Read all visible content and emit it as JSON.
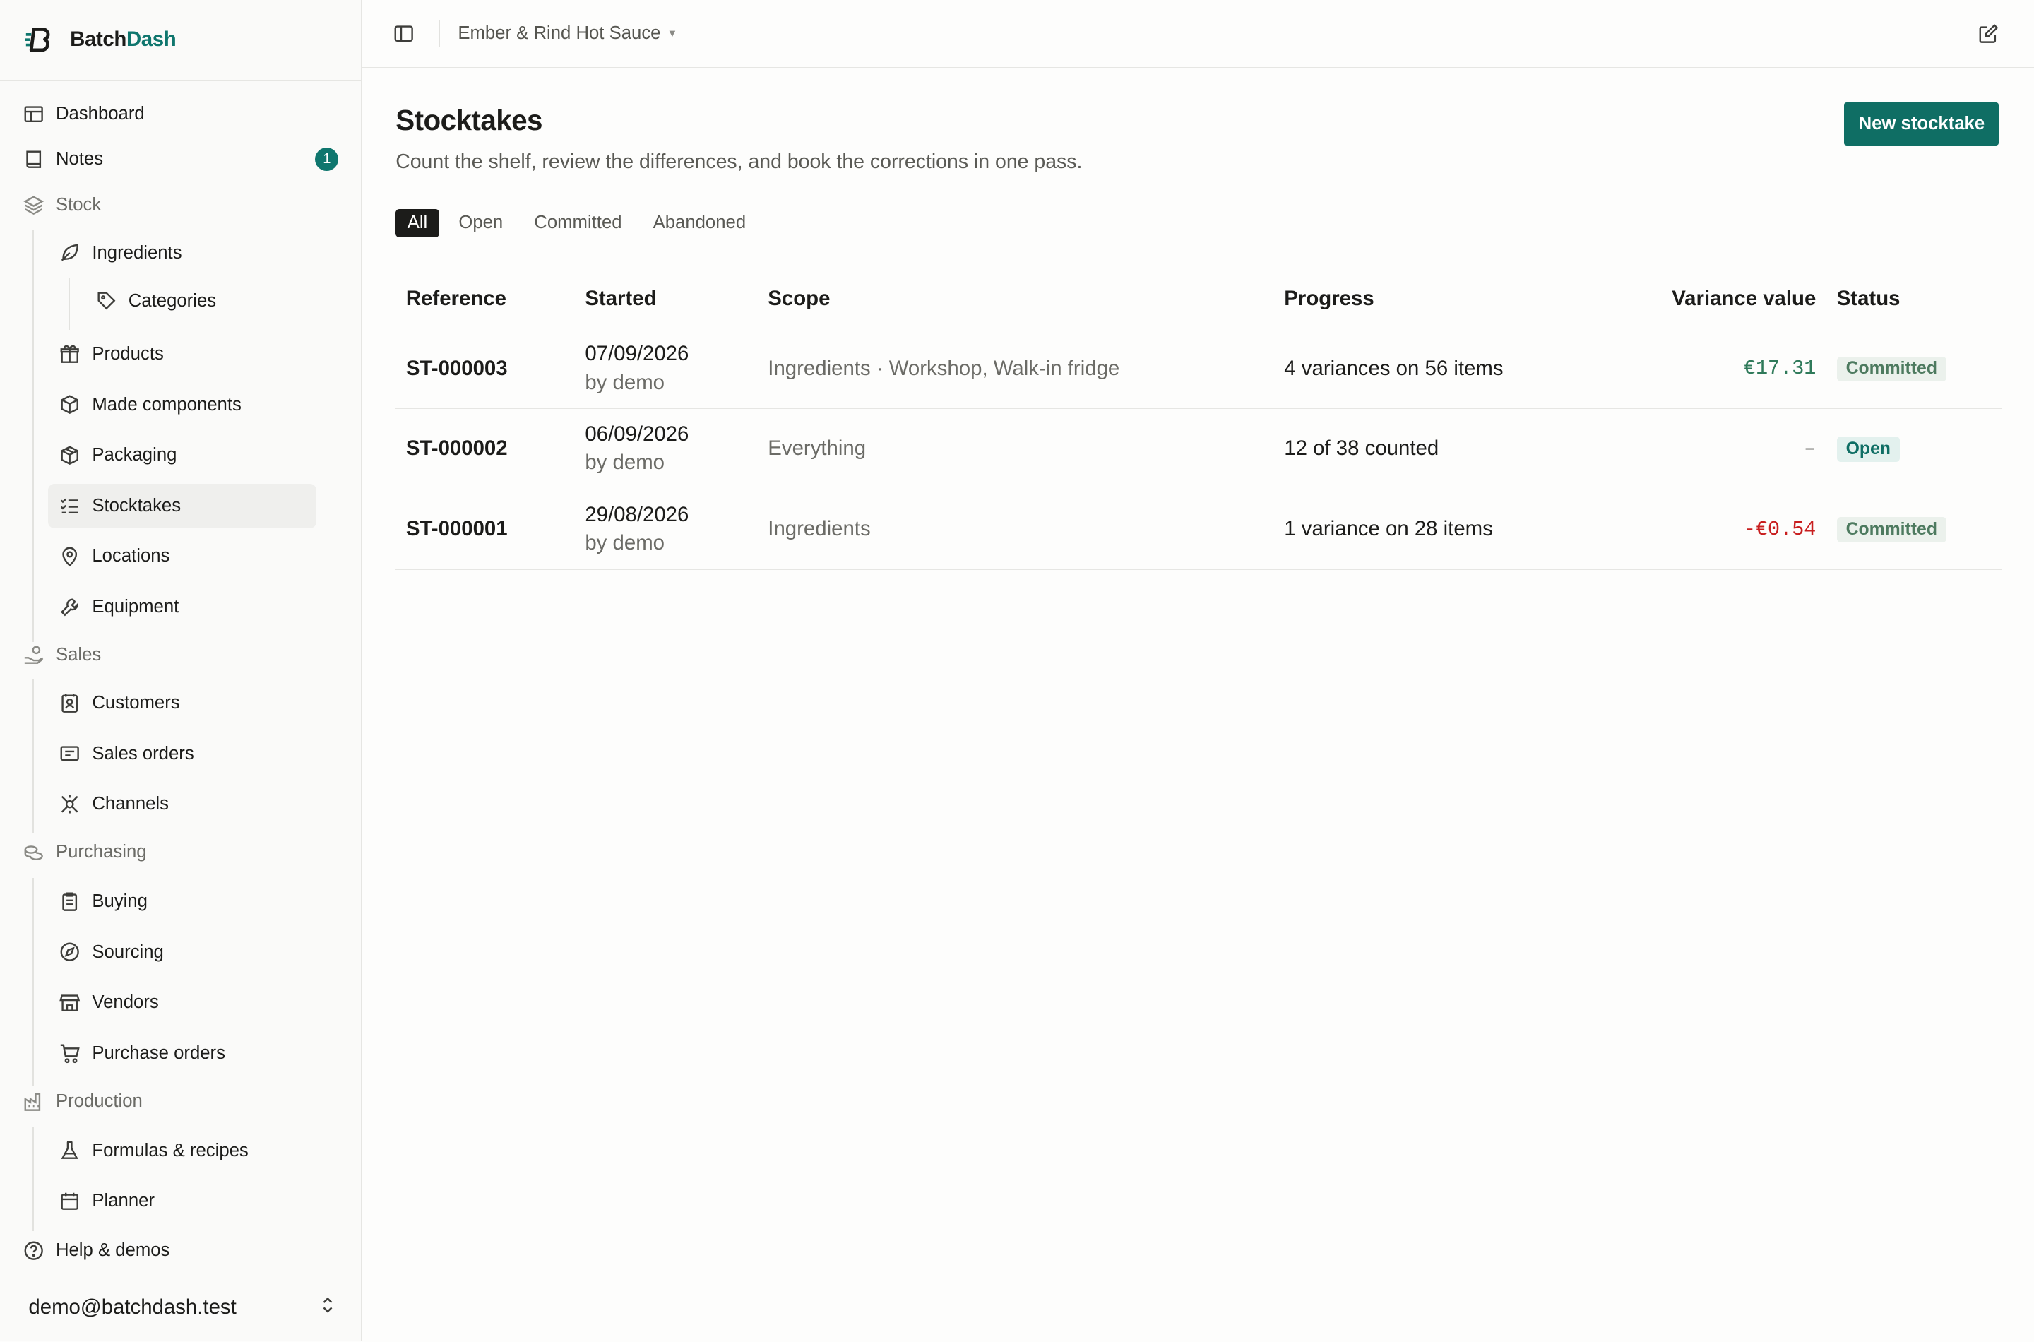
{
  "brand": {
    "name_main": "Batch",
    "name_accent": "Dash"
  },
  "sidebar": {
    "dashboard": "Dashboard",
    "notes": "Notes",
    "notes_badge": "1",
    "stock": "Stock",
    "ingredients": "Ingredients",
    "categories": "Categories",
    "products": "Products",
    "made_components": "Made components",
    "packaging": "Packaging",
    "stocktakes": "Stocktakes",
    "locations": "Locations",
    "equipment": "Equipment",
    "sales": "Sales",
    "customers": "Customers",
    "sales_orders": "Sales orders",
    "channels": "Channels",
    "purchasing": "Purchasing",
    "buying": "Buying",
    "sourcing": "Sourcing",
    "vendors": "Vendors",
    "purchase_orders": "Purchase orders",
    "production": "Production",
    "formulas": "Formulas & recipes",
    "planner": "Planner",
    "help": "Help & demos",
    "account": "demo@batchdash.test"
  },
  "topbar": {
    "workspace": "Ember & Rind Hot Sauce"
  },
  "page": {
    "title": "Stocktakes",
    "subtitle": "Count the shelf, review the differences, and book the corrections in one pass.",
    "new_button": "New stocktake"
  },
  "tabs": [
    "All",
    "Open",
    "Committed",
    "Abandoned"
  ],
  "table": {
    "headers": {
      "reference": "Reference",
      "started": "Started",
      "scope": "Scope",
      "progress": "Progress",
      "variance": "Variance value",
      "status": "Status"
    },
    "rows": [
      {
        "reference": "ST-000003",
        "date": "07/09/2026",
        "by": "by demo",
        "scope": "Ingredients · Workshop, Walk-in fridge",
        "progress": "4 variances on 56 items",
        "variance": "€17.31",
        "status": "Committed"
      },
      {
        "reference": "ST-000002",
        "date": "06/09/2026",
        "by": "by demo",
        "scope": "Everything",
        "progress": "12 of 38 counted",
        "variance": "–",
        "status": "Open"
      },
      {
        "reference": "ST-000001",
        "date": "29/08/2026",
        "by": "by demo",
        "scope": "Ingredients",
        "progress": "1 variance on 28 items",
        "variance": "-€0.54",
        "status": "Committed"
      }
    ]
  },
  "colors": {
    "accent": "#0f766e",
    "positive": "#2f7a5a",
    "negative": "#c81e1e"
  }
}
